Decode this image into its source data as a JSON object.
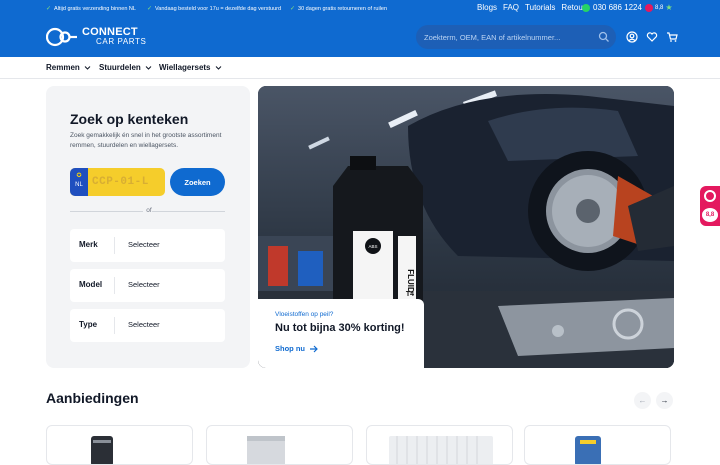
{
  "topbar": {
    "usps": [
      "Altijd gratis verzending binnen NL",
      "Vandaag besteld voor 17u = dezelfde dag verstuurd",
      "30 dagen gratis retourneren of ruilen"
    ],
    "links": [
      "Blogs",
      "FAQ",
      "Tutorials",
      "Retour"
    ],
    "phone": "030 686 1224",
    "rating": "8,8"
  },
  "header": {
    "logo_line1": "CONNECT",
    "logo_line2": "CAR PARTS",
    "search_placeholder": "Zoekterm, OEM, EAN of artikelnummer...",
    "icons": [
      "user-icon",
      "heart-icon",
      "cart-icon"
    ]
  },
  "nav": {
    "items": [
      "Remmen",
      "Stuurdelen",
      "Wiellagersets"
    ]
  },
  "kenteken": {
    "title": "Zoek op kenteken",
    "description": "Zoek gemakkelijk én snel in het grootste assortiment remmen, stuurdelen en wiellagersets.",
    "country": "NL",
    "plate_placeholder": "CCP-01-L",
    "button": "Zoeken",
    "or": "of",
    "selects": [
      {
        "label": "Merk",
        "value": "Selecteer"
      },
      {
        "label": "Model",
        "value": "Selecteer"
      },
      {
        "label": "Type",
        "value": "Selecteer"
      }
    ]
  },
  "hero": {
    "promo_kicker": "Vloeistoffen op peil?",
    "promo_title": "Nu tot bijna 30% korting!",
    "promo_link": "Shop nu",
    "bottle_brand": "ABS",
    "bottle_label": "FLUID",
    "bottle_spec": "T4"
  },
  "side_widget": {
    "score": "8,8"
  },
  "offers": {
    "title": "Aanbiedingen",
    "prev": "←",
    "next": "→"
  },
  "colors": {
    "brand_blue": "#0f6ad0",
    "panel_grey": "#f3f4f6",
    "plate_yellow": "#f5cd2b",
    "kiyoh_pink": "#e4195f"
  }
}
